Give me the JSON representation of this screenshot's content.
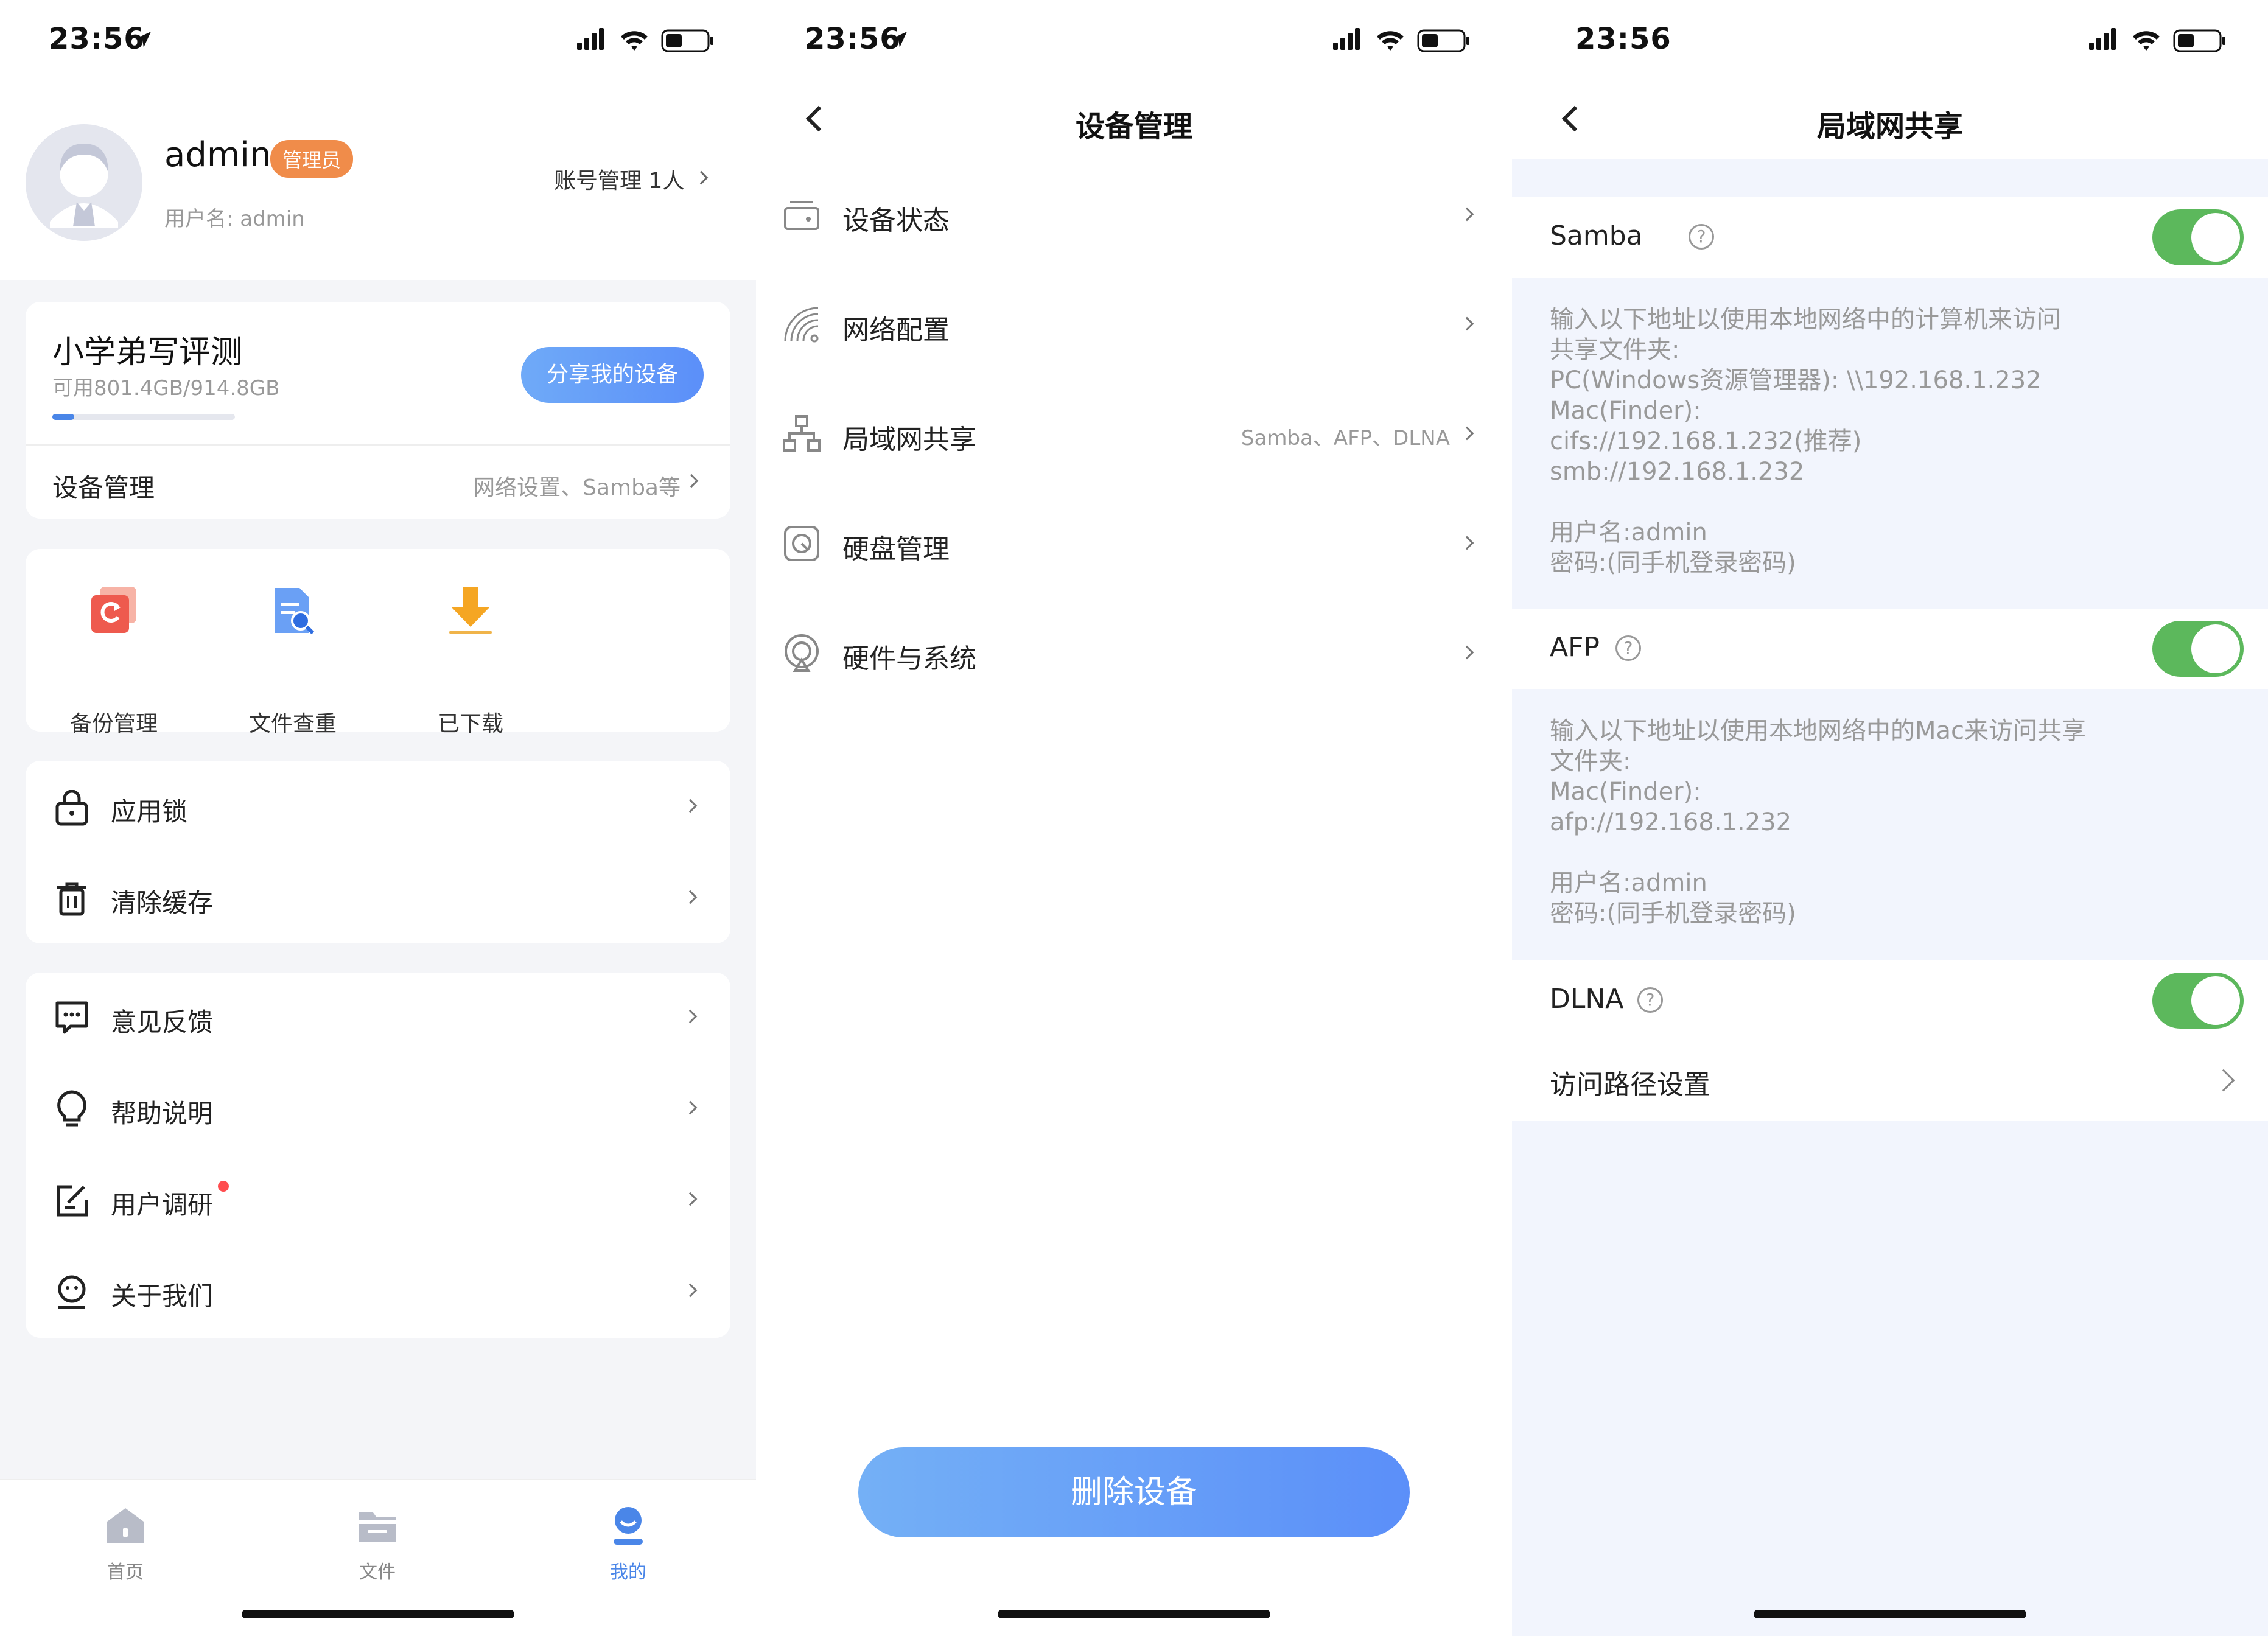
{
  "statusbar": {
    "time": "23:56"
  },
  "screen1": {
    "profile": {
      "name": "admin",
      "badge": "管理员",
      "username": "用户名: admin",
      "account_mgmt": "账号管理 1人"
    },
    "device": {
      "name": "小学弟写评测",
      "storage": "可用801.4GB/914.8GB",
      "storage_used_fraction": 0.12,
      "share_button": "分享我的设备",
      "mgmt_label": "设备管理",
      "mgmt_sub": "网络设置、Samba等"
    },
    "tools": [
      {
        "label": "备份管理",
        "icon": "backup-icon"
      },
      {
        "label": "文件查重",
        "icon": "file-search-icon"
      },
      {
        "label": "已下载",
        "icon": "download-icon"
      }
    ],
    "group1": [
      {
        "label": "应用锁",
        "icon": "lock-icon"
      },
      {
        "label": "清除缓存",
        "icon": "trash-icon"
      }
    ],
    "group2": [
      {
        "label": "意见反馈",
        "icon": "feedback-icon"
      },
      {
        "label": "帮助说明",
        "icon": "bulb-icon"
      },
      {
        "label": "用户调研",
        "icon": "survey-icon"
      },
      {
        "label": "关于我们",
        "icon": "about-icon"
      }
    ],
    "tabbar": [
      {
        "label": "首页",
        "icon": "home-icon"
      },
      {
        "label": "文件",
        "icon": "folder-icon"
      },
      {
        "label": "我的",
        "icon": "profile-icon",
        "active": true
      }
    ],
    "colors": {
      "accent": "#5b8ff9",
      "badge": "#f08c4a",
      "active_tab": "#4a86e8",
      "dot": "#ff4d4f"
    }
  },
  "screen2": {
    "title": "设备管理",
    "items": [
      {
        "label": "设备状态",
        "sub": "",
        "icon": "device-status-icon"
      },
      {
        "label": "网络配置",
        "sub": "",
        "icon": "wifi-config-icon"
      },
      {
        "label": "局域网共享",
        "sub": "Samba、AFP、DLNA",
        "icon": "lan-share-icon"
      },
      {
        "label": "硬盘管理",
        "sub": "",
        "icon": "disk-icon"
      },
      {
        "label": "硬件与系统",
        "sub": "",
        "icon": "hardware-icon"
      }
    ],
    "delete_button": "删除设备"
  },
  "screen3": {
    "title": "局域网共享",
    "samba": {
      "label": "Samba",
      "enabled": true,
      "info": "输入以下地址以使用本地网络中的计算机来访问\n共享文件夹:\nPC(Windows资源管理器): \\\\192.168.1.232\nMac(Finder):\ncifs://192.168.1.232(推荐)\nsmb://192.168.1.232\n\n用户名:admin\n密码:(同手机登录密码)"
    },
    "afp": {
      "label": "AFP",
      "enabled": true,
      "info": "输入以下地址以使用本地网络中的Mac来访问共享\n文件夹:\nMac(Finder):\nafp://192.168.1.232\n\n用户名:admin\n密码:(同手机登录密码)"
    },
    "dlna": {
      "label": "DLNA",
      "enabled": true
    },
    "path_setting": "访问路径设置",
    "colors": {
      "toggle_on": "#5cb85c",
      "info_bg": "#f2f5fd"
    }
  }
}
